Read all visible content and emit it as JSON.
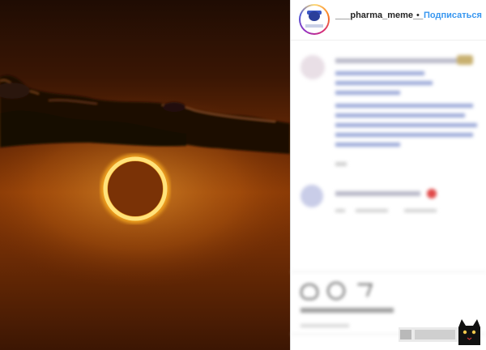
{
  "post": {
    "username": "___pharma_meme__",
    "separator": "•",
    "follow_label": "Подписаться"
  },
  "colors": {
    "link_blue": "#3897f0",
    "sky_dark": "#1f0c03",
    "sky_orange": "#8a3a06",
    "ring_glow": "#ffd24a"
  },
  "icons": [
    "heart-icon",
    "comment-icon",
    "share-icon",
    "emoji-icon",
    "cat-icon"
  ]
}
